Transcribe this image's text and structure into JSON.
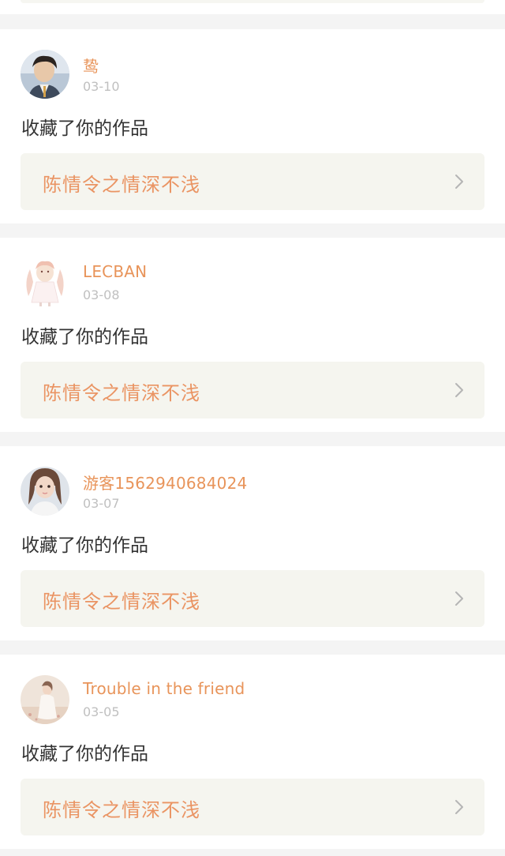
{
  "colors": {
    "accent": "#e8945a",
    "date_text": "#c0c0c0",
    "body_text": "#333333",
    "link_bg": "#f5f5ef",
    "page_bg": "#f4f4f4"
  },
  "notifications": [
    {
      "username": "鸷",
      "date": "03-10",
      "action": "收藏了你的作品",
      "work_title": "陈情令之情深不浅",
      "avatar_icon": "user-avatar-icon",
      "chevron_icon": "chevron-right-icon"
    },
    {
      "username": "LECBAN",
      "date": "03-08",
      "action": "收藏了你的作品",
      "work_title": "陈情令之情深不浅",
      "avatar_icon": "user-avatar-icon",
      "chevron_icon": "chevron-right-icon"
    },
    {
      "username": "游客1562940684024",
      "date": "03-07",
      "action": "收藏了你的作品",
      "work_title": "陈情令之情深不浅",
      "avatar_icon": "user-avatar-icon",
      "chevron_icon": "chevron-right-icon"
    },
    {
      "username": "Trouble in the friend",
      "date": "03-05",
      "action": "收藏了你的作品",
      "work_title": "陈情令之情深不浅",
      "avatar_icon": "user-avatar-icon",
      "chevron_icon": "chevron-right-icon"
    }
  ]
}
